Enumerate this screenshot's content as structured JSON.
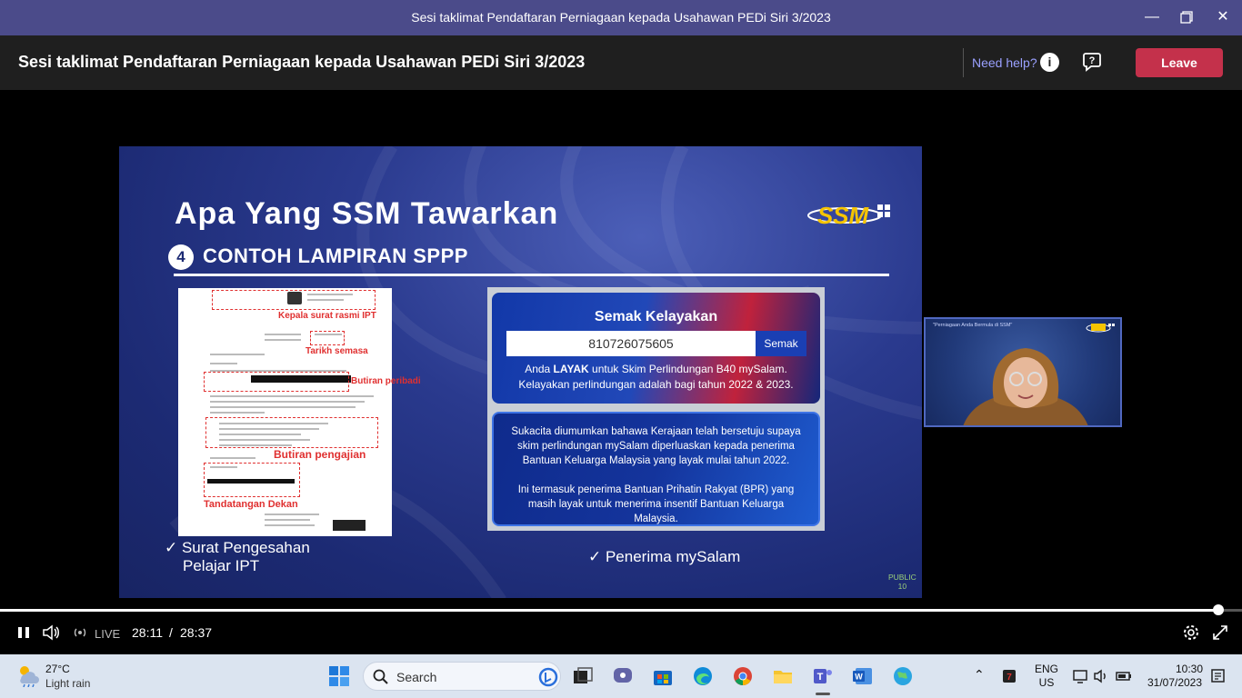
{
  "window": {
    "title": "Sesi taklimat Pendaftaran Perniagaan kepada Usahawan PEDi Siri 3/2023"
  },
  "meeting": {
    "title": "Sesi taklimat Pendaftaran Perniagaan kepada Usahawan PEDi Siri 3/2023",
    "need_help": "Need help?",
    "leave": "Leave"
  },
  "slide": {
    "title": "Apa Yang SSM Tawarkan",
    "number": "4",
    "subtitle": "CONTOH LAMPIRAN SPPP",
    "logo_text": "SSM",
    "doc_labels": {
      "kepala": "Kepala surat rasmi IPT",
      "tarikh": "Tarikh semasa",
      "butiran_peribadi": "Butiran peribadi",
      "butiran_pengajian": "Butiran pengajian",
      "tandatangan": "Tandatangan Dekan"
    },
    "left_check": [
      "✓ Surat Pengesahan",
      "Pelajar IPT"
    ],
    "right_check": "✓ Penerima mySalam",
    "card1": {
      "title": "Semak Kelayakan",
      "ic_value": "810726075605",
      "button": "Semak",
      "msg_prefix": "Anda ",
      "msg_bold": "LAYAK",
      "msg_rest": " untuk Skim Perlindungan B40 mySalam. Kelayakan perlindungan adalah bagi tahun 2022 & 2023."
    },
    "card2": {
      "p1": "Sukacita diumumkan bahawa Kerajaan telah bersetuju supaya skim perlindungan mySalam diperluaskan kepada penerima Bantuan Keluarga Malaysia yang layak mulai tahun 2022.",
      "p2": "Ini termasuk penerima Bantuan Prihatin Rakyat (BPR) yang masih layak untuk menerima insentif Bantuan Keluarga Malaysia."
    },
    "footer_public": "PUBLIC",
    "footer_page": "10"
  },
  "webcam": {
    "caption": "\"Perniagaan Anda Bermula di SSM\""
  },
  "player": {
    "live": "LIVE",
    "current_time": "28:11",
    "separator": "/",
    "total_time": "28:37",
    "progress": 0.981
  },
  "taskbar": {
    "temperature": "27°C",
    "weather": "Light rain",
    "search_placeholder": "Search",
    "lang_line1": "ENG",
    "lang_line2": "US",
    "time": "10:30",
    "date": "31/07/2023"
  }
}
